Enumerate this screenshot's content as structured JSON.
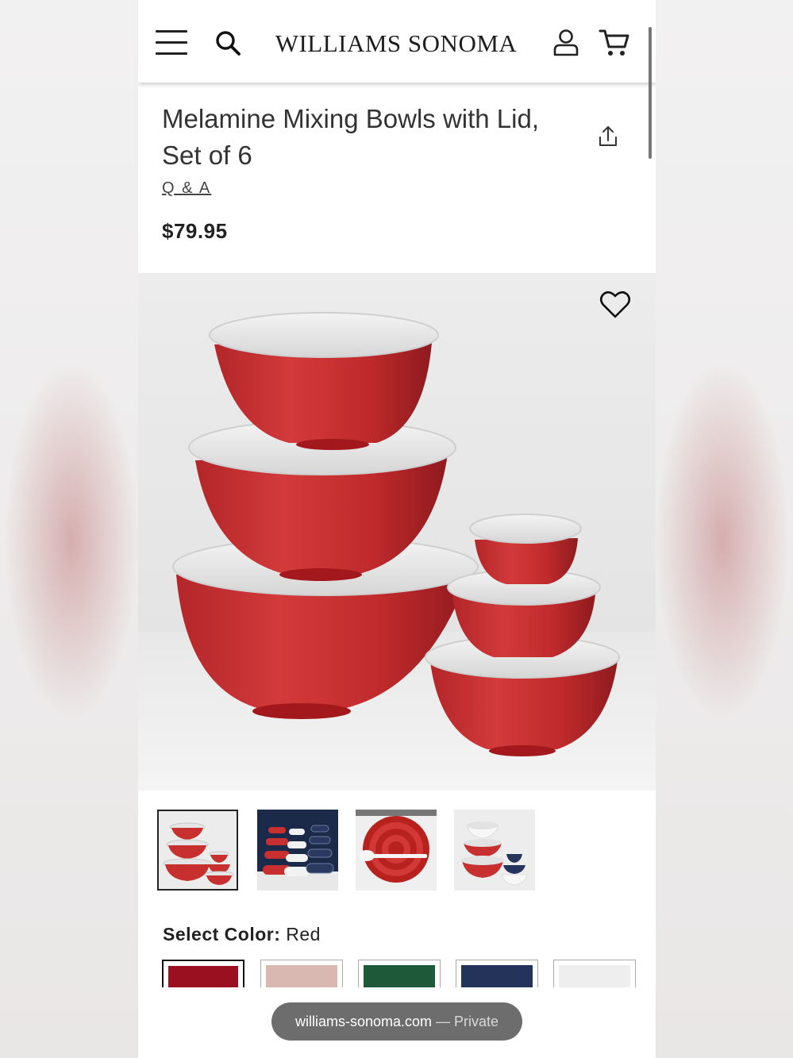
{
  "header": {
    "brand": "WILLIAMS SONOMA",
    "menu_icon": "hamburger-menu-icon",
    "search_icon": "search-icon",
    "account_icon": "user-account-icon",
    "cart_icon": "shopping-cart-icon"
  },
  "product": {
    "title_line1": "Melamine Mixing Bowls with Lid,",
    "title_line2": "Set of 6",
    "qa_link": "Q & A",
    "price": "$79.95",
    "share_icon": "share-icon",
    "favorite_icon": "heart-icon"
  },
  "gallery": {
    "thumbnails": [
      {
        "name": "red-bowls-stacked",
        "selected": true
      },
      {
        "name": "assorted-colors-stacks",
        "selected": false
      },
      {
        "name": "nested-red-bowls-with-spatula",
        "selected": false
      },
      {
        "name": "white-red-navy-bowls",
        "selected": false
      }
    ]
  },
  "color_select": {
    "label": "Select Color:",
    "value": "Red",
    "swatches": [
      {
        "name": "Red",
        "color": "#9a1020",
        "selected": true
      },
      {
        "name": "Blush",
        "color": "#d9b8b2",
        "selected": false
      },
      {
        "name": "Green",
        "color": "#1e5a3a",
        "selected": false
      },
      {
        "name": "Navy",
        "color": "#23335a",
        "selected": false
      },
      {
        "name": "White",
        "color": "#eeeeee",
        "selected": false
      }
    ]
  },
  "browser": {
    "url": "williams-sonoma.com",
    "mode": "— Private"
  }
}
